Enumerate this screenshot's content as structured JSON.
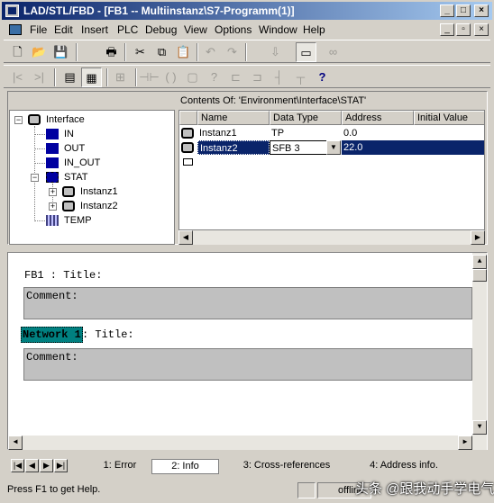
{
  "window": {
    "title": "LAD/STL/FBD - [FB1 -- Multiinstanz\\S7-Programm(1)]",
    "controls": {
      "minimize": "_",
      "maximize": "□",
      "close": "×"
    }
  },
  "menu": {
    "items": [
      {
        "label": "File"
      },
      {
        "label": "Edit"
      },
      {
        "label": "Insert"
      },
      {
        "label": "PLC"
      },
      {
        "label": "Debug"
      },
      {
        "label": "View"
      },
      {
        "label": "Options"
      },
      {
        "label": "Window"
      },
      {
        "label": "Help"
      }
    ],
    "mdi_controls": {
      "minimize": "_",
      "restore": "▫",
      "close": "×"
    }
  },
  "toolbar1": {
    "buttons": [
      {
        "icon": "new-icon",
        "glyph": "🗋"
      },
      {
        "icon": "open-icon",
        "glyph": "📂"
      },
      {
        "icon": "save-icon",
        "glyph": "💾"
      },
      {
        "icon": "print-icon",
        "glyph": "🖶"
      },
      {
        "icon": "cut-icon",
        "glyph": "✂"
      },
      {
        "icon": "copy-icon",
        "glyph": "⧉"
      },
      {
        "icon": "paste-icon",
        "glyph": "📋"
      },
      {
        "icon": "undo-icon",
        "glyph": "↶"
      },
      {
        "icon": "redo-icon",
        "glyph": "↷"
      },
      {
        "icon": "download-icon",
        "glyph": "⇩"
      },
      {
        "icon": "monitor-icon",
        "glyph": "▭"
      },
      {
        "icon": "glasses-icon",
        "glyph": "∞"
      }
    ]
  },
  "toolbar2": {
    "buttons": [
      {
        "icon": "network-start-icon",
        "glyph": "|<"
      },
      {
        "icon": "network-end-icon",
        "glyph": ">|"
      },
      {
        "icon": "overview-icon",
        "glyph": "▤"
      },
      {
        "icon": "details-icon",
        "glyph": "▦"
      },
      {
        "icon": "new-network-icon",
        "glyph": "⊞"
      },
      {
        "icon": "ladder-contact-icon",
        "glyph": "⊣⊢"
      },
      {
        "icon": "ladder-coil-icon",
        "glyph": "( )"
      },
      {
        "icon": "box-icon",
        "glyph": "▢"
      },
      {
        "icon": "branch-icon",
        "glyph": "?"
      },
      {
        "icon": "open-branch-icon",
        "glyph": "⊏"
      },
      {
        "icon": "close-branch-icon",
        "glyph": "⊐"
      },
      {
        "icon": "connection-icon",
        "glyph": "┤"
      },
      {
        "icon": "parallel-icon",
        "glyph": "┬"
      },
      {
        "icon": "whats-this-icon",
        "glyph": "?"
      }
    ]
  },
  "tree": {
    "items": [
      {
        "label": "Interface",
        "icon": "block-icon"
      },
      {
        "label": "IN",
        "icon": "pin-icon"
      },
      {
        "label": "OUT",
        "icon": "pin-icon"
      },
      {
        "label": "IN_OUT",
        "icon": "pin-icon"
      },
      {
        "label": "STAT",
        "icon": "pin-icon",
        "expanded": true
      },
      {
        "label": "Instanz1",
        "icon": "instance-icon"
      },
      {
        "label": "Instanz2",
        "icon": "instance-icon"
      },
      {
        "label": "TEMP",
        "icon": "temp-icon"
      }
    ],
    "expand_plus": "+",
    "expand_minus": "−"
  },
  "contents": {
    "header": "Contents Of: 'Environment\\Interface\\STAT'",
    "columns": [
      "Name",
      "Data Type",
      "Address",
      "Initial Value"
    ],
    "rows": [
      {
        "name": "Instanz1",
        "type": "TP",
        "address": "0.0",
        "initial": ""
      },
      {
        "name": "Instanz2",
        "type": "SFB 3",
        "address": "22.0",
        "initial": ""
      },
      {
        "name": "",
        "type": "",
        "address": "",
        "initial": ""
      }
    ],
    "selected_row": 1
  },
  "editor": {
    "block_title": "FB1 : Title:",
    "block_comment": "Comment:",
    "network_label": "Network 1",
    "network_title": ": Title:",
    "network_comment": "Comment:"
  },
  "tabs": {
    "items": [
      {
        "label": "1: Error"
      },
      {
        "label": "2: Info"
      },
      {
        "label": "3: Cross-references"
      },
      {
        "label": "4: Address info."
      }
    ],
    "active": 1
  },
  "status": {
    "help_text": "Press F1 to get Help.",
    "mode": "offline",
    "watermark": "头条 @跟我动手学电气"
  },
  "colors": {
    "titlebar_start": "#0a246a",
    "titlebar_end": "#a6caf0",
    "selection": "#0a246a",
    "network_label_bg": "#008080",
    "comment_bg": "#c0c0c0"
  }
}
